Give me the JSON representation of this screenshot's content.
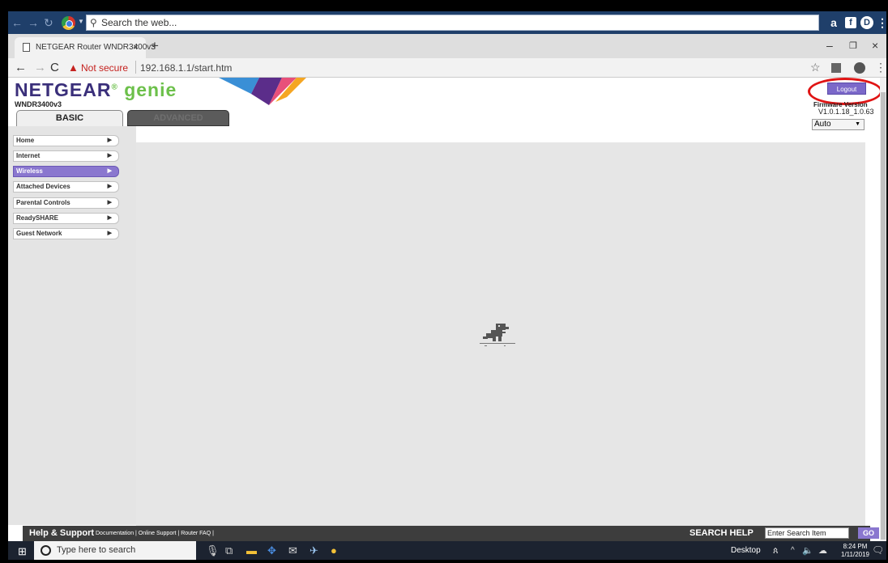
{
  "topbar": {
    "search_placeholder": "Search the web...",
    "ext_icons": [
      "amazon-icon",
      "facebook-icon",
      "dashlane-icon",
      "menu-dots-icon"
    ]
  },
  "browser": {
    "tab_title": "NETGEAR Router WNDR3400v3",
    "new_tab": "+",
    "not_secure": "Not secure",
    "url": "192.168.1.1/start.htm"
  },
  "netgear": {
    "brand": "NETGEAR",
    "brand_suffix": "genie",
    "model": "WNDR3400v3",
    "logout": "Logout",
    "firmware_label": "Firmware Version",
    "firmware_value": "V1.0.1.18_1.0.63",
    "language": "Auto",
    "tabs": {
      "basic": "BASIC",
      "advanced": "ADVANCED"
    },
    "menu": [
      {
        "label": "Home",
        "active": false
      },
      {
        "label": "Internet",
        "active": false
      },
      {
        "label": "Wireless",
        "active": true
      },
      {
        "label": "Attached Devices",
        "active": false
      },
      {
        "label": "Parental Controls",
        "active": false
      },
      {
        "label": "ReadySHARE",
        "active": false
      },
      {
        "label": "Guest Network",
        "active": false
      }
    ]
  },
  "help": {
    "title": "Help & Support",
    "links": "Documentation | Online Support | Router FAQ |",
    "search_label": "SEARCH HELP",
    "search_value": "Enter Search Item",
    "go": "GO"
  },
  "taskbar": {
    "search_placeholder": "Type here to search",
    "desktop": "Desktop",
    "time": "8:24 PM",
    "date": "1/11/2019"
  },
  "colors": {
    "accent": "#8a77cf",
    "brand": "#3a2f7a",
    "annotation": "#e01414"
  }
}
